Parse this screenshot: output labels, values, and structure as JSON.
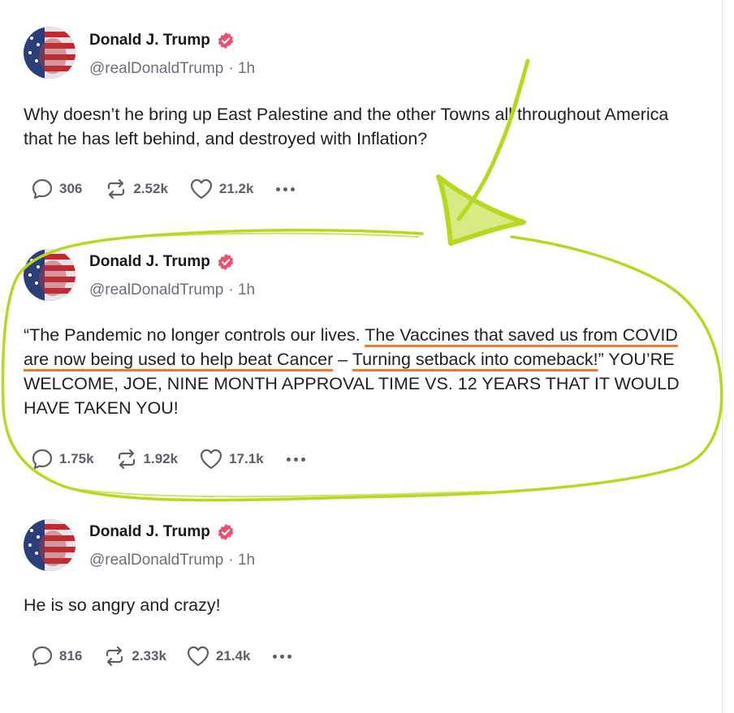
{
  "colors": {
    "accent_scribble": "#b6d91f",
    "underline": "#f07a2a",
    "verified_badge": "#ef4e6c",
    "muted": "#6b6f7a"
  },
  "icons": {
    "reply": "speech-bubble-icon",
    "repost": "repost-arrows-icon",
    "like": "heart-icon",
    "more": "three-dots-icon",
    "verified": "verified-badge-icon"
  },
  "posts": [
    {
      "author": "Donald J. Trump",
      "handle": "@realDonaldTrump",
      "time": "· 1h",
      "text": "Why doesn’t he bring up East Palestine and the other Towns all throughout America that he has left behind, and destroyed with Inflation?",
      "replies": "306",
      "reposts": "2.52k",
      "likes": "21.2k"
    },
    {
      "author": "Donald J. Trump",
      "handle": "@realDonaldTrump",
      "time": "· 1h",
      "text_parts": [
        "“The Pandemic no longer controls our lives. ",
        "The Vaccines that saved us from COVID are now being used to help beat Cancer",
        " – ",
        "Turning setback into comeback!",
        "” YOU’RE WELCOME, JOE, NINE MONTH APPROVAL TIME VS. 12 YEARS THAT IT WOULD HAVE TAKEN YOU!"
      ],
      "replies": "1.75k",
      "reposts": "1.92k",
      "likes": "17.1k"
    },
    {
      "author": "Donald J. Trump",
      "handle": "@realDonaldTrump",
      "time": "· 1h",
      "text": "He is so angry and crazy!",
      "replies": "816",
      "reposts": "2.33k",
      "likes": "21.4k"
    }
  ]
}
